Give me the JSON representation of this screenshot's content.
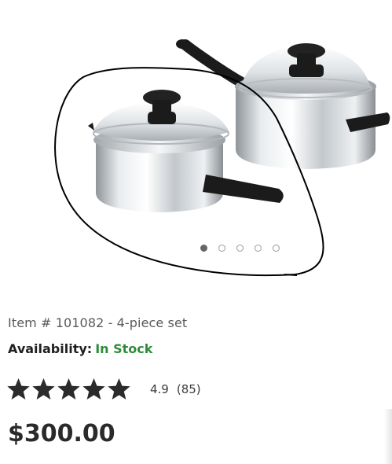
{
  "carousel": {
    "slide_count": 5,
    "active_index": 0,
    "image_alt": "product-photo-cookware"
  },
  "product": {
    "item_line": "Item # 101082 - 4-piece set",
    "availability_label": "Availability:",
    "availability_status": "In Stock",
    "rating_value": "4.9",
    "rating_count": "(85)",
    "stars_filled": 5,
    "price": "$300.00"
  },
  "colors": {
    "in_stock": "#2e8b3a",
    "stars": "#2b2b2b",
    "annotation_ink": "#000000"
  },
  "icons": {
    "star": "star-icon",
    "dot": "carousel-dot-icon"
  }
}
